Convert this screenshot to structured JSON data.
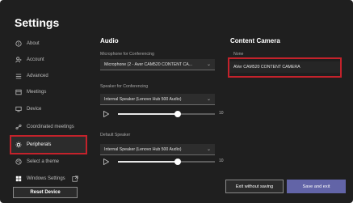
{
  "window": {
    "title": "Settings"
  },
  "sidebar": {
    "items": [
      {
        "label": "About",
        "icon": "info-icon"
      },
      {
        "label": "Account",
        "icon": "account-icon"
      },
      {
        "label": "Advanced",
        "icon": "advanced-icon"
      },
      {
        "label": "Meetings",
        "icon": "meetings-icon"
      },
      {
        "label": "Device",
        "icon": "device-icon"
      },
      {
        "label": "Coordinated meetings",
        "icon": "link-icon"
      },
      {
        "label": "Peripherals",
        "icon": "peripherals-icon",
        "selected": true
      },
      {
        "label": "Select a theme",
        "icon": "theme-icon"
      },
      {
        "label": "Windows Settings",
        "icon": "windows-icon",
        "trailing_icon": "external-link-icon"
      }
    ],
    "reset_label": "Reset Device"
  },
  "audio": {
    "heading": "Audio",
    "mic_label": "Microphone for Conferencing",
    "mic_value": "Microphone (2 - Aver CAM520 CONTENT CA...",
    "speaker_label": "Speaker for Conferencing",
    "speaker_value": "Internal Speaker (Lenovo Hub 500 Audio)",
    "speaker_volume": 0.62,
    "speaker_volume_text": "10",
    "default_label": "Default Speaker",
    "default_value": "Internal Speaker (Lenovo Hub 500 Audio)",
    "default_volume": 0.62,
    "default_volume_text": "10"
  },
  "camera": {
    "heading": "Content Camera",
    "label": "None",
    "value": "AVer CAM520 CONTENT CAMERA"
  },
  "footer": {
    "exit_label": "Exit without saving",
    "save_label": "Save and exit"
  },
  "colors": {
    "accent": "#6264a7",
    "highlight": "#c4222b",
    "background": "#1f1f1f"
  }
}
